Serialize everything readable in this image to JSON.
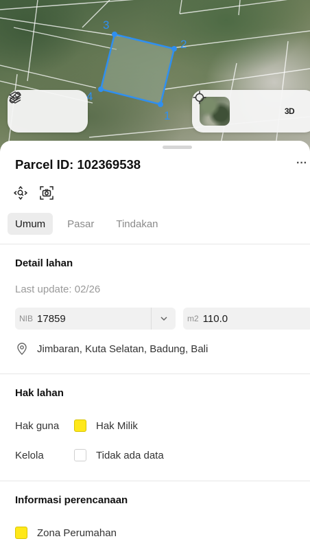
{
  "map": {
    "parcel_vertex_labels": [
      "3",
      "2",
      "4",
      "1"
    ],
    "parcel_color": "#2f8ff0",
    "left_controls": {
      "layers_icon": "layers-icon",
      "measure_icon": "ruler-icon"
    },
    "right_controls": {
      "basemap_icon": "satellite-thumbnail",
      "locate_icon": "crosshair-icon",
      "three_d_label": "3D"
    }
  },
  "sheet": {
    "title": "Parcel ID: 102369538",
    "more_label": "···",
    "tools": [
      "zoom-to-parcel-icon",
      "screenshot-icon"
    ],
    "tabs": [
      {
        "label": "Umum",
        "active": true
      },
      {
        "label": "Pasar",
        "active": false
      },
      {
        "label": "Tindakan",
        "active": false
      }
    ],
    "detail": {
      "title": "Detail lahan",
      "last_update": "Last update: 02/26",
      "nib_label": "NIB",
      "nib_value": "17859",
      "area_label": "m2",
      "area_value": "110.0",
      "location": "Jimbaran, Kuta Selatan, Badung, Bali"
    },
    "rights": {
      "title": "Hak lahan",
      "rows": [
        {
          "key": "Hak guna",
          "value": "Hak Milik",
          "swatch": "#ffe81a"
        },
        {
          "key": "Kelola",
          "value": "Tidak ada data",
          "swatch": "none"
        }
      ]
    },
    "planning": {
      "title": "Informasi perencanaan",
      "zone": "Zona Perumahan",
      "zone_color": "#ffe81a"
    }
  }
}
